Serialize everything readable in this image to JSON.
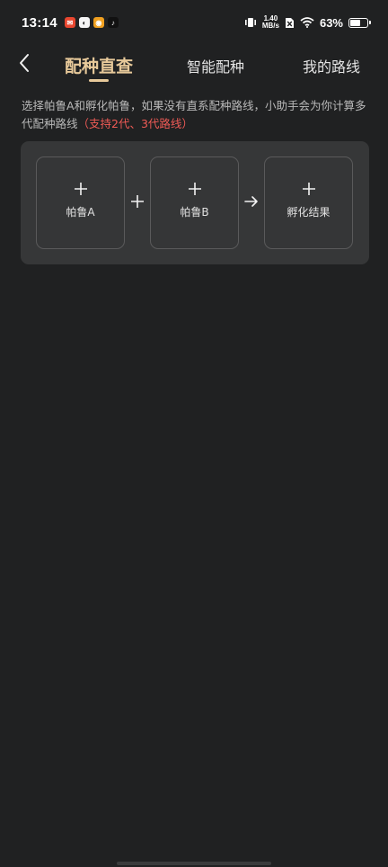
{
  "status_bar": {
    "time": "13:14",
    "net_speed_value": "1.40",
    "net_speed_unit": "MB/s",
    "battery_percent": "63%",
    "battery_level": 0.63
  },
  "nav": {
    "tabs": [
      {
        "label": "配种直查",
        "active": true
      },
      {
        "label": "智能配种",
        "active": false
      },
      {
        "label": "我的路线",
        "active": false
      }
    ]
  },
  "description": {
    "text": "选择帕鲁A和孵化帕鲁，如果没有直系配种路线，小助手会为你计算多代配种路线",
    "highlight": "（支持2代、3代路线）"
  },
  "breeding": {
    "parent_a_label": "帕鲁A",
    "parent_b_label": "帕鲁B",
    "result_label": "孵化结果"
  },
  "colors": {
    "accent": "#e7c99a",
    "highlight": "#f05b56",
    "background": "#202122",
    "card": "#363738"
  }
}
